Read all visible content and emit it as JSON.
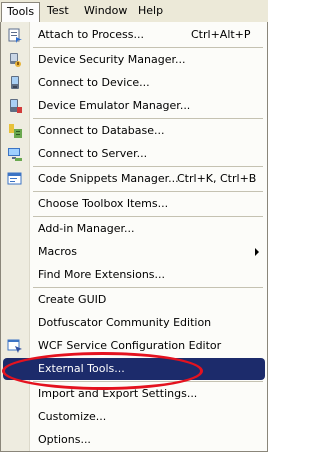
{
  "menubar": {
    "items": [
      {
        "label": "Tools",
        "active": true
      },
      {
        "label": "Test"
      },
      {
        "label": "Window"
      },
      {
        "label": "Help"
      }
    ]
  },
  "menu": {
    "attach": {
      "label": "Attach to Process...",
      "shortcut": "Ctrl+Alt+P",
      "icon": "attach-icon"
    },
    "device_security": {
      "label": "Device Security Manager...",
      "icon": "security-icon"
    },
    "connect_device": {
      "label": "Connect to Device...",
      "icon": "device-icon"
    },
    "emulator": {
      "label": "Device Emulator Manager...",
      "icon": "emulator-icon"
    },
    "connect_db": {
      "label": "Connect to Database...",
      "icon": "database-icon"
    },
    "connect_server": {
      "label": "Connect to Server...",
      "icon": "server-icon"
    },
    "snippets": {
      "label": "Code Snippets Manager...",
      "shortcut": "Ctrl+K, Ctrl+B",
      "icon": "snippets-icon"
    },
    "toolbox": {
      "label": "Choose Toolbox Items..."
    },
    "addin": {
      "label": "Add-in Manager..."
    },
    "macros": {
      "label": "Macros"
    },
    "extensions": {
      "label": "Find More Extensions..."
    },
    "guid": {
      "label": "Create GUID"
    },
    "dotfuscator": {
      "label": "Dotfuscator Community Edition"
    },
    "wcf": {
      "label": "WCF Service Configuration Editor",
      "icon": "wcf-icon"
    },
    "external": {
      "label": "External Tools..."
    },
    "import_export": {
      "label": "Import and Export Settings..."
    },
    "customize": {
      "label": "Customize..."
    },
    "options": {
      "label": "Options..."
    }
  },
  "colors": {
    "highlight": "#1c2b6b",
    "annotation": "#e4121f",
    "gutter": "#eeece0"
  }
}
